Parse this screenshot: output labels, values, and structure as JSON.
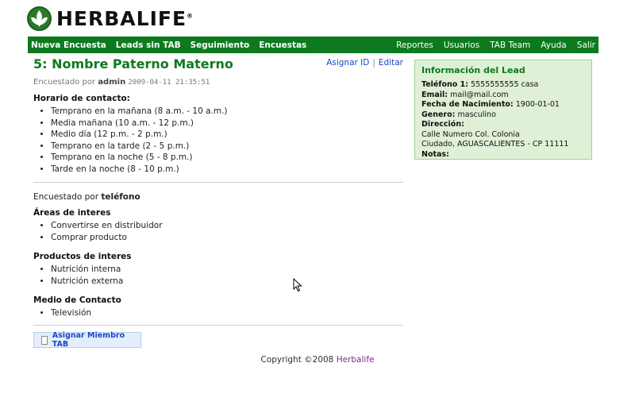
{
  "logo": {
    "text": "HERBALIFE"
  },
  "nav": {
    "left": [
      "Nueva Encuesta",
      "Leads sin TAB",
      "Seguimiento",
      "Encuestas"
    ],
    "right": [
      "Reportes",
      "Usuarios",
      "TAB Team",
      "Ayuda",
      "Salir"
    ]
  },
  "lead": {
    "title": "5: Nombre Paterno Materno",
    "assign_id": "Asignar ID",
    "separator": "|",
    "edit": "Editar",
    "surveyed_by_prefix": "Encuestado por",
    "surveyed_by_user": "admin",
    "surveyed_date": "2009-04-11 21:35:51",
    "contact_schedule_heading": "Horario de contacto:",
    "contact_schedule": [
      "Temprano en la mañana (8 a.m. - 10 a.m.)",
      "Media mañana (10 a.m. - 12 p.m.)",
      "Medio día (12 p.m. - 2 p.m.)",
      "Temprano en la tarde (2 - 5 p.m.)",
      "Temprano en la noche (5 - 8 p.m.)",
      "Tarde en la noche (8 - 10 p.m.)"
    ],
    "surveyed_via_prefix": "Encuestado por",
    "surveyed_via": "teléfono",
    "interest_areas_heading": "Áreas de interes",
    "interest_areas": [
      "Convertirse en distribuidor",
      "Comprar producto"
    ],
    "products_heading": "Productos de interes",
    "products": [
      "Nutrición interna",
      "Nutrición externa"
    ],
    "contact_medium_heading": "Medio de Contacto",
    "contact_medium": [
      "Televisión"
    ],
    "assign_tab_button": "Asignar Miembro TAB"
  },
  "sidebar": {
    "title": "Información del Lead",
    "phone_label": "Teléfono 1:",
    "phone_value": "5555555555 casa",
    "email_label": "Email:",
    "email_value": "mail@mail.com",
    "birth_label": "Fecha de Nacimiento:",
    "birth_value": "1900-01-01",
    "gender_label": "Genero:",
    "gender_value": "masculino",
    "address_label": "Dirección:",
    "address_line1": "Calle Numero Col. Colonia",
    "address_line2": "Ciudado, AGUASCALIENTES - CP 11111",
    "notes_label": "Notas:"
  },
  "footer": {
    "copyright": "Copyright ©2008",
    "brand": "Herbalife"
  }
}
